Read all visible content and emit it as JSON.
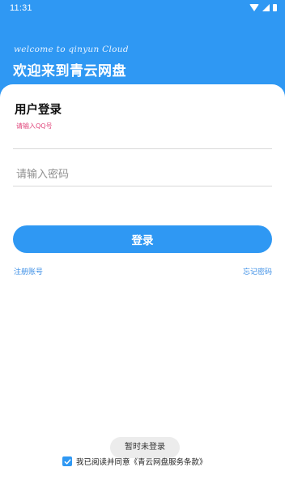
{
  "status_bar": {
    "time": "11:31"
  },
  "header": {
    "welcome_en": "welcome to qinyun Cloud",
    "welcome_cn": "欢迎来到青云网盘"
  },
  "login": {
    "title": "用户登录",
    "qq_label": "请输入QQ号",
    "qq_value": "",
    "password_placeholder": "请输入密码",
    "password_value": "",
    "login_button": "登录",
    "register_link": "注册账号",
    "forgot_link": "忘记密码"
  },
  "toast": {
    "text": "暂时未登录"
  },
  "agreement": {
    "checked": true,
    "text": "我已阅读并同意《青云网盘服务条款》"
  },
  "colors": {
    "primary": "#2f98f3",
    "label_pink": "#e0447a",
    "link_blue": "#3d8fe6"
  }
}
